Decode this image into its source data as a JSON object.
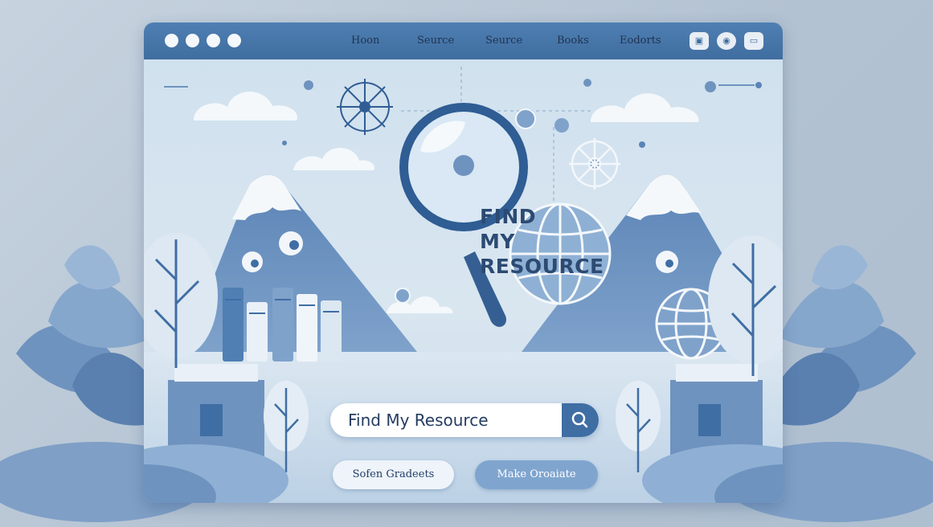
{
  "window": {
    "nav": [
      "Hoon",
      "Seurce",
      "Seurce",
      "Books",
      "Eodorts"
    ]
  },
  "hero": {
    "line1": "FIND",
    "line2": "MY",
    "line3": "RESOURCE"
  },
  "search": {
    "value": "Find My Resource"
  },
  "buttons": {
    "grad": "Sofen Gradeets",
    "make": "Make Oroaiate"
  },
  "colors": {
    "accent": "#3f6ea4",
    "titlebar": "#4f7fb3",
    "ink": "#2c4a72"
  },
  "icons": [
    "search-icon",
    "magnifier-illustration",
    "globe-icon",
    "compass-wheel-icon",
    "book-stack"
  ]
}
